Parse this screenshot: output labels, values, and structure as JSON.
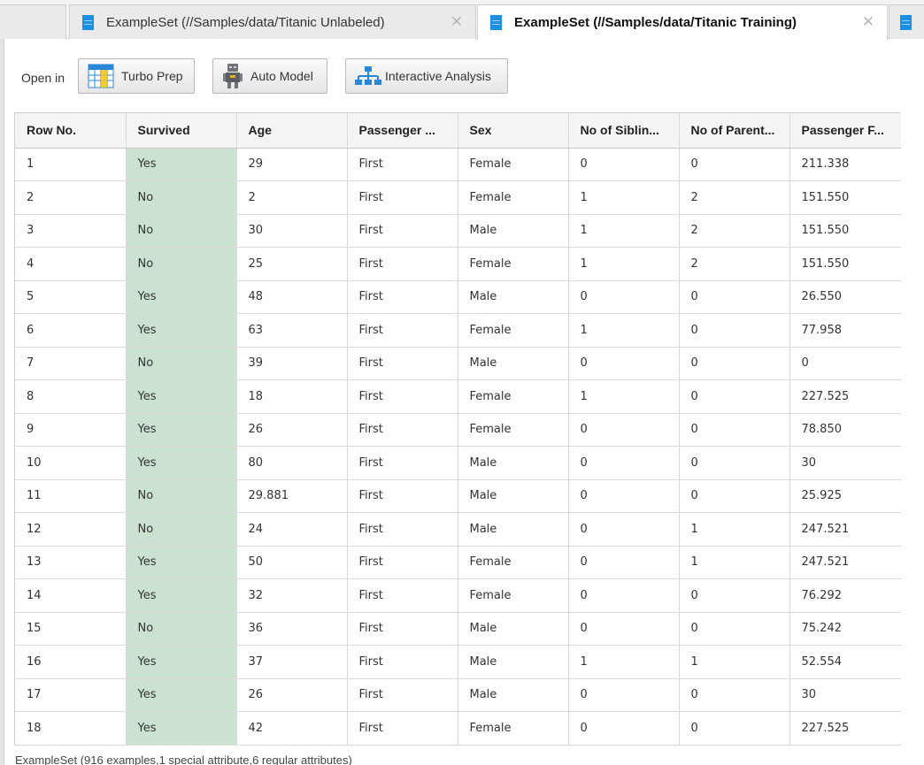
{
  "tabs": [
    {
      "label": "ExampleSet (//Samples/data/Titanic Unlabeled)",
      "active": false
    },
    {
      "label": "ExampleSet (//Samples/data/Titanic Training)",
      "active": true
    }
  ],
  "toolbar": {
    "open_in_label": "Open in",
    "turbo_prep_label": "Turbo Prep",
    "auto_model_label": "Auto Model",
    "interactive_analysis_label": "Interactive Analysis"
  },
  "table": {
    "columns": [
      "Row No.",
      "Survived",
      "Age",
      "Passenger ...",
      "Sex",
      "No of Siblin...",
      "No of Parent...",
      "Passenger F..."
    ],
    "rows": [
      [
        "1",
        "Yes",
        "29",
        "First",
        "Female",
        "0",
        "0",
        "211.338"
      ],
      [
        "2",
        "No",
        "2",
        "First",
        "Female",
        "1",
        "2",
        "151.550"
      ],
      [
        "3",
        "No",
        "30",
        "First",
        "Male",
        "1",
        "2",
        "151.550"
      ],
      [
        "4",
        "No",
        "25",
        "First",
        "Female",
        "1",
        "2",
        "151.550"
      ],
      [
        "5",
        "Yes",
        "48",
        "First",
        "Male",
        "0",
        "0",
        "26.550"
      ],
      [
        "6",
        "Yes",
        "63",
        "First",
        "Female",
        "1",
        "0",
        "77.958"
      ],
      [
        "7",
        "No",
        "39",
        "First",
        "Male",
        "0",
        "0",
        "0"
      ],
      [
        "8",
        "Yes",
        "18",
        "First",
        "Female",
        "1",
        "0",
        "227.525"
      ],
      [
        "9",
        "Yes",
        "26",
        "First",
        "Female",
        "0",
        "0",
        "78.850"
      ],
      [
        "10",
        "Yes",
        "80",
        "First",
        "Male",
        "0",
        "0",
        "30"
      ],
      [
        "11",
        "No",
        "29.881",
        "First",
        "Male",
        "0",
        "0",
        "25.925"
      ],
      [
        "12",
        "No",
        "24",
        "First",
        "Male",
        "0",
        "1",
        "247.521"
      ],
      [
        "13",
        "Yes",
        "50",
        "First",
        "Female",
        "0",
        "1",
        "247.521"
      ],
      [
        "14",
        "Yes",
        "32",
        "First",
        "Female",
        "0",
        "0",
        "76.292"
      ],
      [
        "15",
        "No",
        "36",
        "First",
        "Male",
        "0",
        "0",
        "75.242"
      ],
      [
        "16",
        "Yes",
        "37",
        "First",
        "Male",
        "1",
        "1",
        "52.554"
      ],
      [
        "17",
        "Yes",
        "26",
        "First",
        "Male",
        "0",
        "0",
        "30"
      ],
      [
        "18",
        "Yes",
        "42",
        "First",
        "Female",
        "0",
        "0",
        "227.525"
      ]
    ]
  },
  "status_text": "ExampleSet (916 examples,1 special attribute,6 regular attributes)",
  "colors": {
    "label_column_bg": "#cbe2d1",
    "accent_blue": "#1c8fe0"
  },
  "icons": {
    "tab_icon": "data-table-icon",
    "turbo_prep_icon": "turbo-prep-icon",
    "auto_model_icon": "robot-icon",
    "interactive_analysis_icon": "hierarchy-icon"
  }
}
